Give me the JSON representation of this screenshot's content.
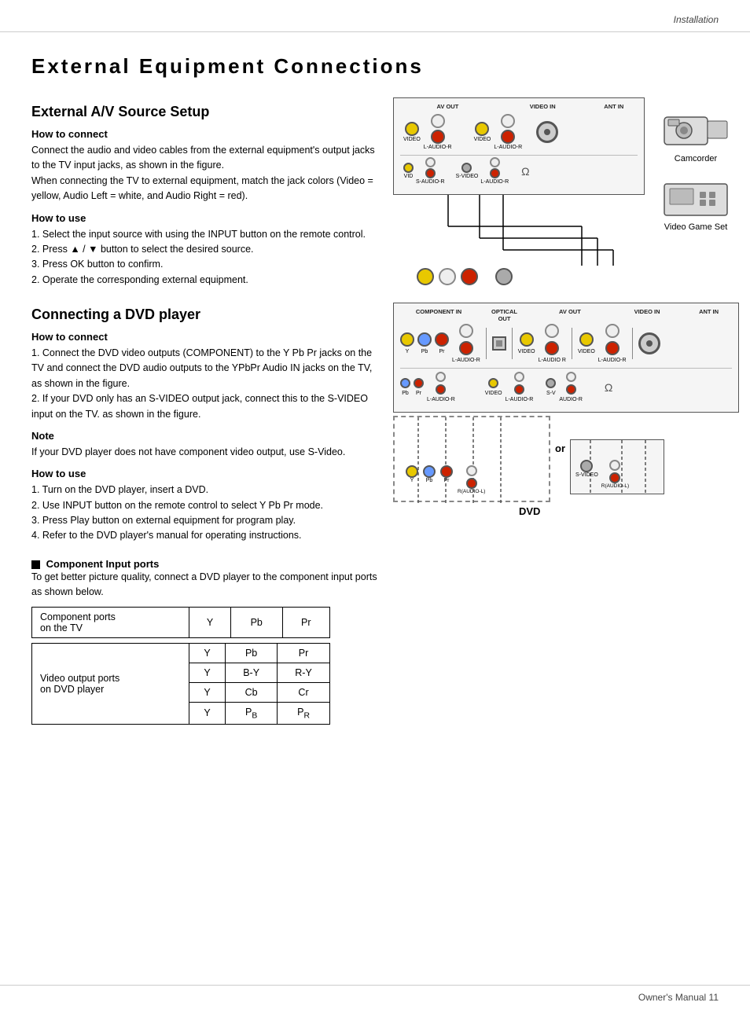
{
  "header": {
    "section": "Installation"
  },
  "main_title": "External Equipment Connections",
  "section1": {
    "heading": "External A/V Source Setup",
    "how_to_connect_label": "How to connect",
    "how_to_connect_text": "Connect the audio and video cables from the external equipment's output jacks to the TV input jacks, as shown in the figure.\nWhen connecting the TV to external equipment, match the jack colors (Video = yellow, Audio Left = white, and Audio Right = red).",
    "how_to_use_label": "How to use",
    "how_to_use_steps": [
      "1. Select the input source with using the INPUT button on the remote control.",
      "2. Press ▲ / ▼ button to select the desired source.",
      "3. Press OK button to confirm.",
      "2. Operate the corresponding external equipment."
    ]
  },
  "section2": {
    "heading": "Connecting a DVD player",
    "how_to_connect_label": "How to connect",
    "connect_steps": [
      "1. Connect the DVD video outputs (COMPONENT) to the Y Pb Pr jacks on the TV and connect the DVD audio outputs to the YPbPr Audio IN jacks on the TV, as shown in the figure.",
      "2. If your DVD only has an S-VIDEO output jack, connect this to the S-VIDEO input on the TV. as shown in the figure."
    ],
    "note_label": "Note",
    "note_text": "If your DVD player does not have component video output, use S-Video.",
    "how_to_use_label": "How to use",
    "use_steps": [
      "1. Turn on the DVD player, insert a DVD.",
      "2. Use INPUT button on the remote control to select Y Pb Pr mode.",
      "3. Press Play button on external equipment for program play.",
      "4. Refer to the DVD player's manual for operating instructions."
    ],
    "component_input_label": "Component Input ports",
    "component_input_text": "To get better picture quality, connect a DVD player to the component input ports as shown below."
  },
  "tv_diagram_top": {
    "labels": [
      "AV OUT",
      "VIDEO IN",
      "ANT IN"
    ],
    "jack_row1": [
      "VIDEO",
      "L-AUDIO-R"
    ],
    "jack_row2": [
      "VIDEO",
      "S-AUDIO-R",
      "S-VIDEO",
      "L-AUDIO-R"
    ]
  },
  "tv_diagram_bottom": {
    "labels": [
      "COMPONENT IN",
      "OPTICAL OUT",
      "AV OUT",
      "VIDEO IN",
      "ANT IN"
    ],
    "jack_labels_row1": [
      "Y",
      "Pb",
      "Pr",
      "L-AUDIO-R",
      "VIDEO",
      "L-AUDIO R"
    ],
    "jack_labels_row2": [
      "Pb",
      "Pr",
      "L-AUDIO-R",
      "VIDEO",
      "L-AUDIO-R",
      "S-V",
      "AUDIO-R"
    ]
  },
  "devices": {
    "camcorder": "Camcorder",
    "video_game": "Video Game Set"
  },
  "dvd_label": "DVD",
  "or_label": "or",
  "port_table_tv": {
    "row_label": "Component ports\non the TV",
    "cols": [
      "Y",
      "Pb",
      "Pr"
    ]
  },
  "port_table_dvd": {
    "row_label": "Video output ports\non DVD player",
    "col1": [
      "Y",
      "Y",
      "Y",
      "Y"
    ],
    "col2": [
      "Pb",
      "B-Y",
      "Cb",
      "PB"
    ],
    "col3": [
      "Pr",
      "R-Y",
      "Cr",
      "PR"
    ]
  },
  "footer": {
    "left": "",
    "right": "Owner's Manual  11"
  }
}
